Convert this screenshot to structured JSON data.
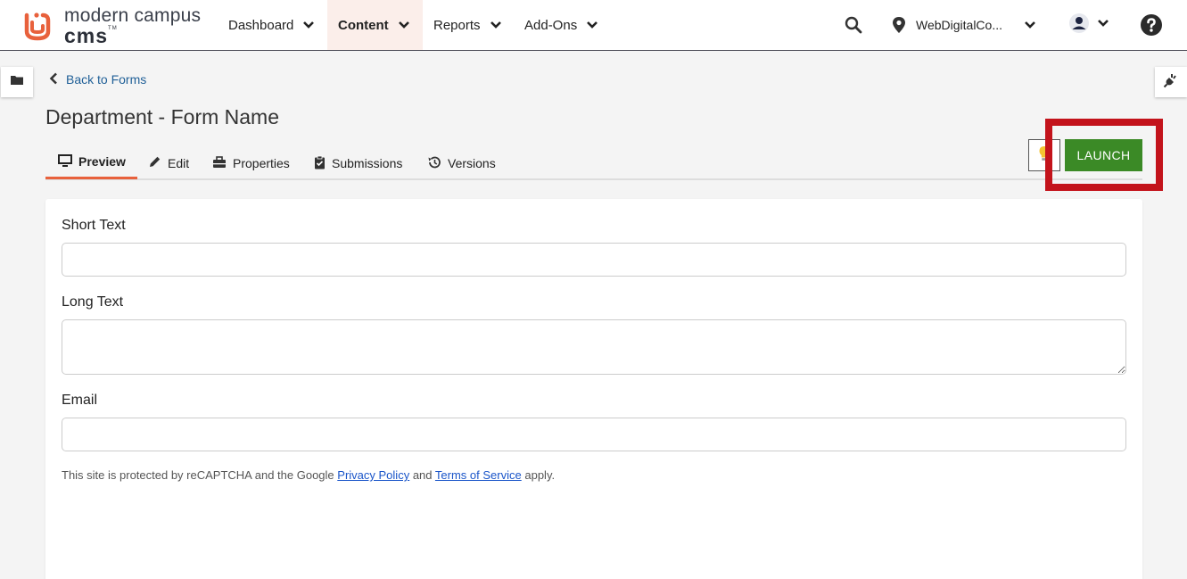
{
  "brand": {
    "line1": "modern campus",
    "line2": "cms",
    "trademark": "TM",
    "accent": "#e8613c"
  },
  "nav": {
    "items": [
      {
        "label": "Dashboard",
        "active": false
      },
      {
        "label": "Content",
        "active": true
      },
      {
        "label": "Reports",
        "active": false
      },
      {
        "label": "Add-Ons",
        "active": false
      }
    ],
    "site_label": "WebDigitalCo..."
  },
  "icons": {
    "search": "search-icon",
    "location": "map-pin-icon",
    "user": "user-icon",
    "help": "help-icon",
    "folder": "folder-icon",
    "plug": "plug-icon",
    "lightbulb": "lightbulb-icon"
  },
  "page": {
    "back_label": "Back to Forms",
    "title": "Department - Form Name"
  },
  "tabs": [
    {
      "label": "Preview",
      "icon": "monitor-icon",
      "active": true
    },
    {
      "label": "Edit",
      "icon": "pencil-icon",
      "active": false
    },
    {
      "label": "Properties",
      "icon": "properties-icon",
      "active": false
    },
    {
      "label": "Submissions",
      "icon": "clipboard-check-icon",
      "active": false
    },
    {
      "label": "Versions",
      "icon": "history-icon",
      "active": false
    }
  ],
  "actions": {
    "launch_label": "LAUNCH",
    "launch_color": "#3b8a26",
    "highlight_color": "#c3131b"
  },
  "form": {
    "fields": [
      {
        "label": "Short Text",
        "type": "text",
        "value": ""
      },
      {
        "label": "Long Text",
        "type": "textarea",
        "value": ""
      },
      {
        "label": "Email",
        "type": "email",
        "value": ""
      }
    ],
    "recaptcha": {
      "prefix": "This site is protected by reCAPTCHA and the Google",
      "privacy": "Privacy Policy",
      "and": "and",
      "terms": "Terms of Service",
      "suffix": "apply."
    }
  }
}
